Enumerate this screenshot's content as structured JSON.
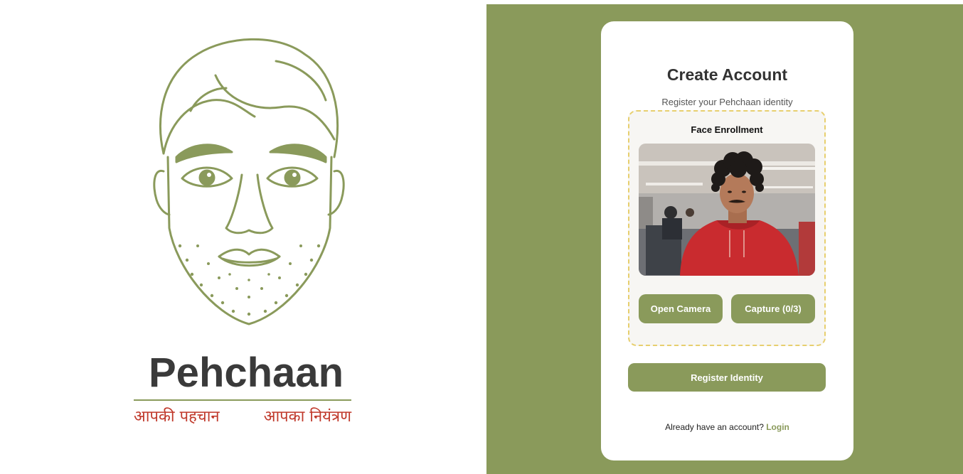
{
  "brand": {
    "name": "Pehchaan",
    "tagline_left": "आपकी पहचान",
    "tagline_right": "आपका नियंत्रण"
  },
  "card": {
    "title": "Create Account",
    "subtitle": "Register your Pehchaan identity",
    "enrollment": {
      "title": "Face Enrollment",
      "open_camera_label": "Open Camera",
      "capture_label": "Capture (0/3)"
    },
    "register_label": "Register Identity",
    "login_prompt": "Already have an account?",
    "login_link": "Login"
  },
  "colors": {
    "accent": "#8a9a5b",
    "tagline": "#c0392b",
    "dashed_border": "#e7cf6e"
  }
}
